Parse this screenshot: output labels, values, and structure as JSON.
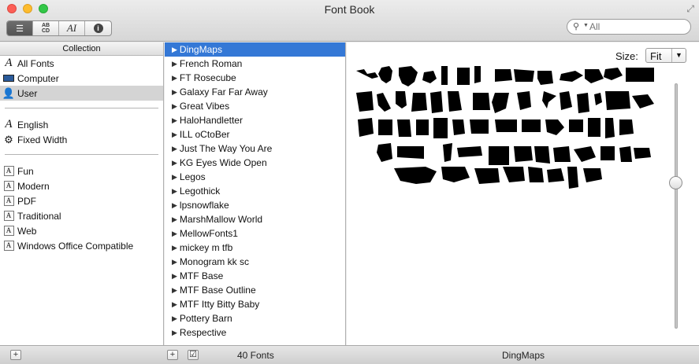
{
  "window": {
    "title": "Font Book"
  },
  "toolbar": {
    "view_buttons": [
      {
        "icon": "list-icon",
        "active": true
      },
      {
        "icon": "abcd-sample-icon",
        "label": "AB CD"
      },
      {
        "icon": "ai-preview-icon",
        "label": "AI"
      },
      {
        "icon": "info-icon",
        "label": "i"
      }
    ]
  },
  "search": {
    "placeholder": "All"
  },
  "collections": {
    "header": "Collection",
    "groups": [
      [
        {
          "label": "All Fonts",
          "icon": "font-script-icon",
          "selected": false
        },
        {
          "label": "Computer",
          "icon": "computer-icon",
          "selected": false
        },
        {
          "label": "User",
          "icon": "user-icon",
          "selected": true
        }
      ],
      [
        {
          "label": "English",
          "icon": "font-script-icon",
          "selected": false
        },
        {
          "label": "Fixed Width",
          "icon": "gear-icon",
          "selected": false
        }
      ],
      [
        {
          "label": "Fun",
          "icon": "collection-box-icon",
          "selected": false
        },
        {
          "label": "Modern",
          "icon": "collection-box-icon",
          "selected": false
        },
        {
          "label": "PDF",
          "icon": "collection-box-icon",
          "selected": false
        },
        {
          "label": "Traditional",
          "icon": "collection-box-icon",
          "selected": false
        },
        {
          "label": "Web",
          "icon": "collection-box-icon",
          "selected": false
        },
        {
          "label": "Windows Office Compatible",
          "icon": "collection-box-icon",
          "selected": false
        }
      ]
    ]
  },
  "fonts": {
    "items": [
      "DingMaps",
      "French Roman",
      "FT Rosecube",
      "Galaxy Far Far Away",
      "Great Vibes",
      "HaloHandletter",
      "ILL oCtoBer",
      "Just The Way You Are",
      "KG Eyes Wide Open",
      "Legos",
      "Legothick",
      "lpsnowflake",
      "MarshMallow World",
      "MellowFonts1",
      "mickey m tfb",
      "Monogram kk sc",
      "MTF Base",
      "MTF Base Outline",
      "MTF Itty Bitty Baby",
      "Pottery Barn",
      "Respective"
    ],
    "selected_index": 0,
    "count_label": "40 Fonts"
  },
  "preview": {
    "size_label": "Size:",
    "size_value": "Fit",
    "slider_level": 0.6,
    "selected_font": "DingMaps"
  },
  "colors": {
    "selection": "#3478d6",
    "glyph": "#000000"
  }
}
